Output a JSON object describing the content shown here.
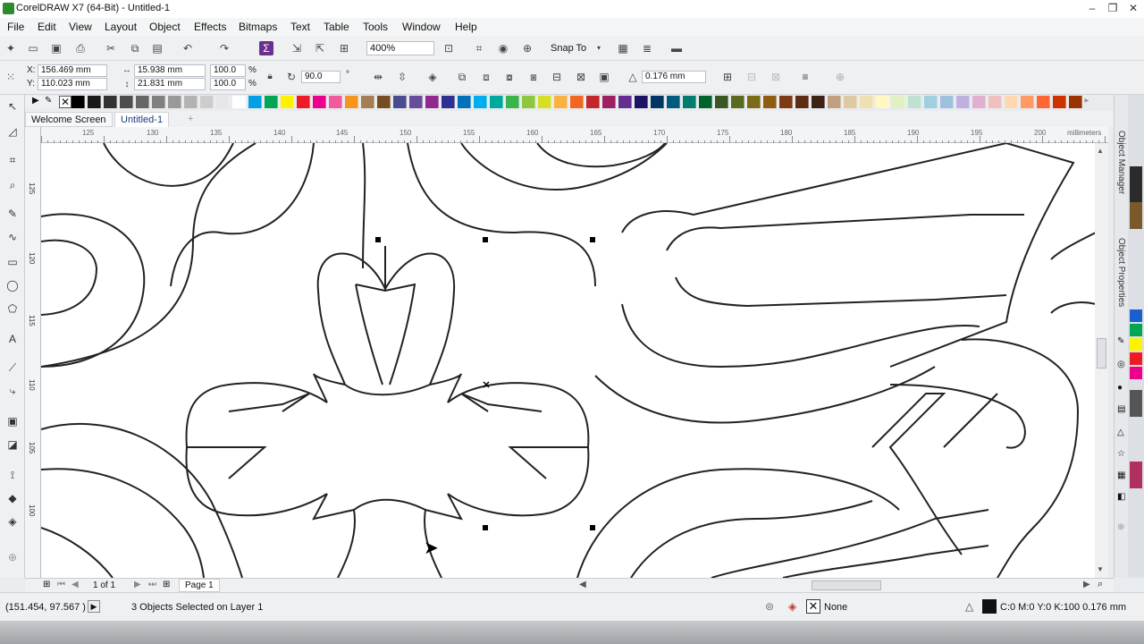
{
  "app": {
    "title": "CorelDRAW X7 (64-Bit) - Untitled-1",
    "window_controls": [
      "–",
      "❐",
      "✕"
    ]
  },
  "menu": [
    "File",
    "Edit",
    "View",
    "Layout",
    "Object",
    "Effects",
    "Bitmaps",
    "Text",
    "Table",
    "Tools",
    "Window",
    "Help"
  ],
  "toolbar": {
    "zoom_value": "400%",
    "snap_to_label": "Snap To"
  },
  "property_bar": {
    "x_label": "X:",
    "x_value": "156.469 mm",
    "y_label": "Y:",
    "y_value": "110.023 mm",
    "width_value": "15.938 mm",
    "height_value": "21.831 mm",
    "scale_x": "100.0",
    "scale_y": "100.0",
    "percent": "%",
    "rotation": "90.0",
    "degree": "°",
    "outline_width": "0.176 mm"
  },
  "palette": [
    "#000000",
    "#1a1a1a",
    "#333333",
    "#4d4d4d",
    "#666666",
    "#808080",
    "#999999",
    "#b3b3b3",
    "#cccccc",
    "#e6e6e6",
    "#ffffff",
    "#00a0e3",
    "#00a651",
    "#fff200",
    "#ed1c24",
    "#ec008c",
    "#f15a9b",
    "#f7941d",
    "#a67c52",
    "#754c24",
    "#4b4b8f",
    "#6a4c9c",
    "#92278f",
    "#2e3192",
    "#0072bc",
    "#00aeef",
    "#00a99d",
    "#39b54a",
    "#8dc63f",
    "#d7df23",
    "#fbb040",
    "#f26522",
    "#c1272d",
    "#9e1f63",
    "#662d91",
    "#1b1464",
    "#003663",
    "#005b7f",
    "#007d6f",
    "#00622c",
    "#385723",
    "#596b1f",
    "#7a6b18",
    "#8f5c12",
    "#7d3a14",
    "#5c2c14",
    "#3c2415",
    "#c0a080",
    "#e0c8a0",
    "#f0e0b0",
    "#fff8c0",
    "#e0f0c0",
    "#c0e0d0",
    "#a0d0e0",
    "#a0c0e0",
    "#c0b0e0",
    "#e0b0d0",
    "#f0c0c0",
    "#ffd8b0",
    "#ff9966",
    "#ff6633",
    "#cc3300",
    "#993300"
  ],
  "tabs": {
    "welcome": "Welcome Screen",
    "doc": "Untitled-1",
    "add": "+"
  },
  "ruler": {
    "labels": [
      "125",
      "130",
      "135",
      "140",
      "145",
      "150",
      "155",
      "160",
      "165",
      "170",
      "175",
      "180",
      "185",
      "190",
      "195",
      "200"
    ],
    "unit": "millimeters",
    "v_labels": [
      "125",
      "120",
      "115",
      "110",
      "105",
      "100"
    ]
  },
  "docker": {
    "object_manager": "Object Manager",
    "object_properties": "Object Properties"
  },
  "page_nav": {
    "count": "1 of 1",
    "page_tab": "Page 1"
  },
  "status": {
    "coords": "(151.454, 97.567 )",
    "selection": "3 Objects Selected on Layer 1",
    "fill": "None",
    "outline": "C:0 M:0 Y:0 K:100  0.176 mm"
  }
}
